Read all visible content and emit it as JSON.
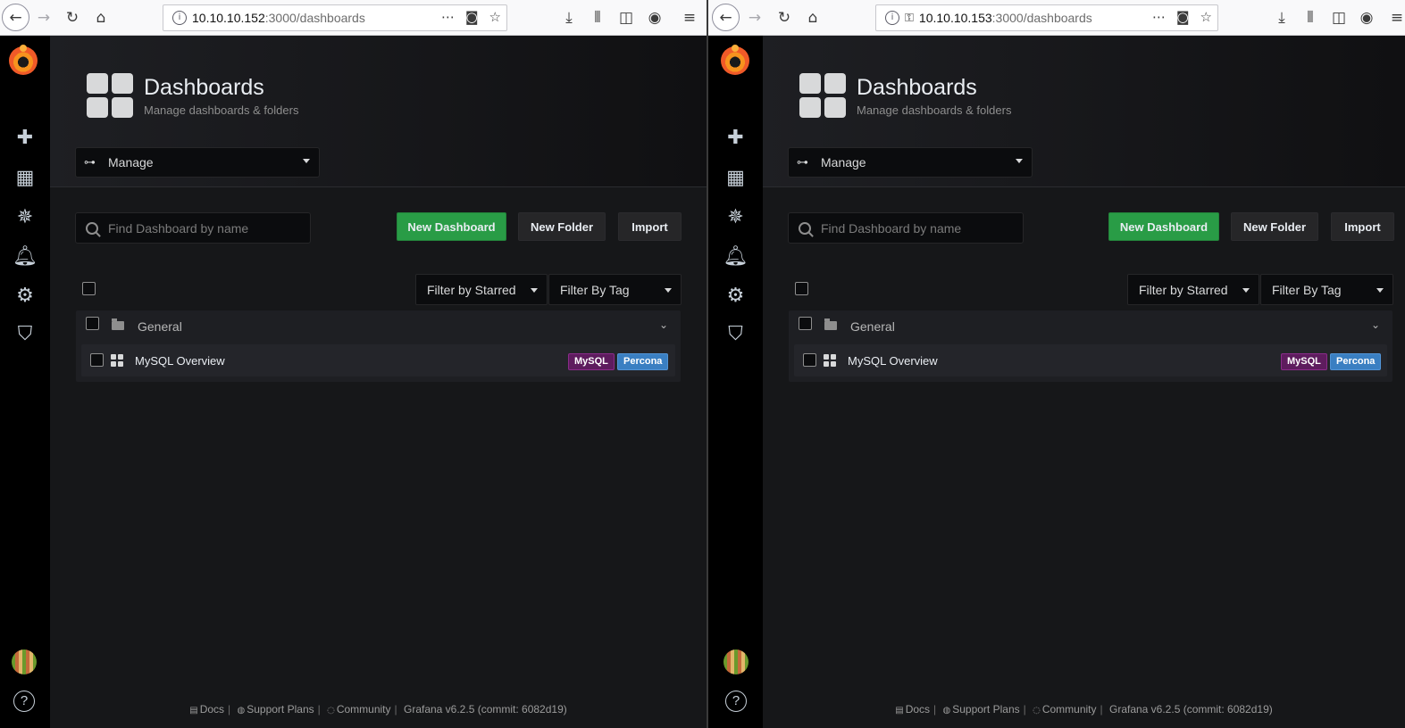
{
  "windows": [
    {
      "url": {
        "host": "10.10.10.152",
        "path": ":3000/dashboards",
        "has_key_icon": false
      },
      "page": {
        "title": "Dashboards",
        "subtitle": "Manage dashboards & folders",
        "nav_select": "Manage",
        "search_placeholder": "Find Dashboard by name",
        "buttons": {
          "new_dashboard": "New Dashboard",
          "new_folder": "New Folder",
          "import": "Import"
        },
        "filters": {
          "starred": "Filter by Starred",
          "tag": "Filter By Tag"
        },
        "folder": {
          "name": "General"
        },
        "dashboard": {
          "name": "MySQL Overview",
          "tags": [
            "MySQL",
            "Percona"
          ]
        }
      },
      "footer": {
        "docs": "Docs",
        "support": "Support Plans",
        "community": "Community",
        "version": "Grafana v6.2.5 (commit: 6082d19)"
      }
    },
    {
      "url": {
        "host": "10.10.10.153",
        "path": ":3000/dashboards",
        "has_key_icon": true
      },
      "page": {
        "title": "Dashboards",
        "subtitle": "Manage dashboards & folders",
        "nav_select": "Manage",
        "search_placeholder": "Find Dashboard by name",
        "buttons": {
          "new_dashboard": "New Dashboard",
          "new_folder": "New Folder",
          "import": "Import"
        },
        "filters": {
          "starred": "Filter by Starred",
          "tag": "Filter By Tag"
        },
        "folder": {
          "name": "General"
        },
        "dashboard": {
          "name": "MySQL Overview",
          "tags": [
            "MySQL",
            "Percona"
          ]
        }
      },
      "footer": {
        "docs": "Docs",
        "support": "Support Plans",
        "community": "Community",
        "version": "Grafana v6.2.5 (commit: 6082d19)"
      }
    }
  ],
  "colors": {
    "primary_button": "#299c46",
    "sidebar_bg": "#000000",
    "page_bg": "#161719",
    "tag_mysql": "#5e1c5e",
    "tag_percona": "#3a7fc2"
  },
  "icons": {
    "sidemenu": [
      "grafana-logo",
      "plus-icon",
      "dashboards-icon",
      "explore-icon",
      "alerting-bell-icon",
      "configuration-gear-icon",
      "server-admin-shield-icon",
      "avatar",
      "help-icon"
    ]
  }
}
